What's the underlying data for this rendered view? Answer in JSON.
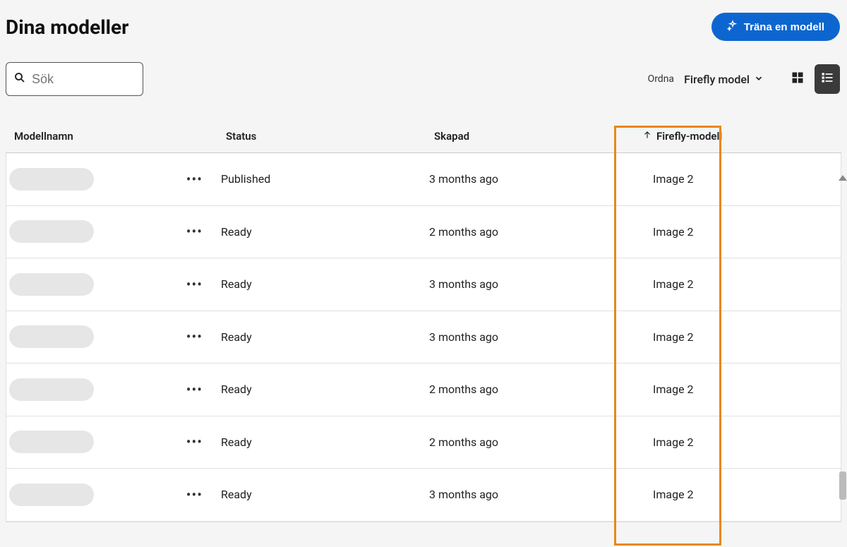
{
  "header": {
    "title": "Dina modeller",
    "train_button": "Träna en modell"
  },
  "search": {
    "placeholder": "Sök"
  },
  "sort": {
    "label": "Ordna",
    "selected": "Firefly model"
  },
  "columns": {
    "name": "Modellnamn",
    "status": "Status",
    "created": "Skapad",
    "firefly": "Firefly-modell"
  },
  "rows": [
    {
      "status": "Published",
      "created": "3 months ago",
      "firefly": "Image 2"
    },
    {
      "status": "Ready",
      "created": "2 months ago",
      "firefly": "Image 2"
    },
    {
      "status": "Ready",
      "created": "3 months ago",
      "firefly": "Image 2"
    },
    {
      "status": "Ready",
      "created": "3 months ago",
      "firefly": "Image 2"
    },
    {
      "status": "Ready",
      "created": "2 months ago",
      "firefly": "Image 2"
    },
    {
      "status": "Ready",
      "created": "2 months ago",
      "firefly": "Image 2"
    },
    {
      "status": "Ready",
      "created": "3 months ago",
      "firefly": "Image 2"
    }
  ]
}
